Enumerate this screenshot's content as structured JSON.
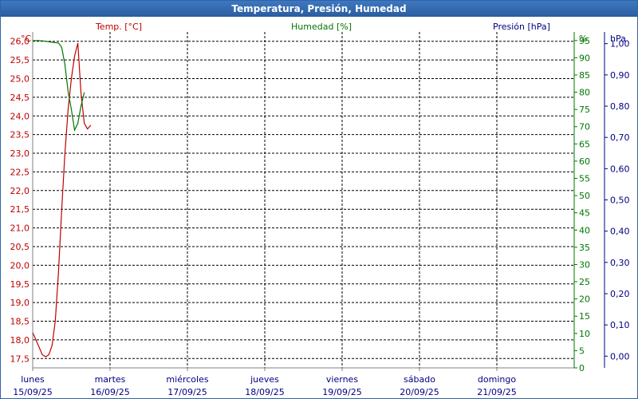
{
  "window": {
    "title": "Temperatura, Presión, Humedad"
  },
  "colors": {
    "temp": "#c00000",
    "hum": "#007700",
    "pres": "#000080",
    "grid": "#000000",
    "title_bg": "#2f63a8"
  },
  "chart_data": {
    "type": "line",
    "title": "Temperatura, Presión, Humedad",
    "grid": true,
    "axes": {
      "temp": {
        "label": "Temp. [°C]",
        "unit": "°C",
        "min": 17.25,
        "max": 26.25,
        "ticks": [
          "17,5",
          "18,0",
          "18,5",
          "19,0",
          "19,5",
          "20,0",
          "20,5",
          "21,0",
          "21,5",
          "22,0",
          "22,5",
          "23,0",
          "23,5",
          "24,0",
          "24,5",
          "25,0",
          "25,5",
          "26,0"
        ]
      },
      "hum": {
        "label": "Humedad [%]",
        "unit": "%",
        "min": 0,
        "max": 97.5,
        "ticks": [
          "0",
          "5",
          "10",
          "15",
          "20",
          "25",
          "30",
          "35",
          "40",
          "45",
          "50",
          "55",
          "60",
          "65",
          "70",
          "75",
          "80",
          "85",
          "90",
          "95"
        ]
      },
      "pres": {
        "label": "Presión [hPa]",
        "unit": "hPa",
        "min": -0.0375,
        "max": 1.0375,
        "ticks": [
          "0,00",
          "0,10",
          "0,20",
          "0,30",
          "0,40",
          "0,50",
          "0,60",
          "0,70",
          "0,80",
          "0,90",
          "1,00"
        ]
      }
    },
    "x_axis": {
      "min_hours": 0,
      "max_hours": 168,
      "categories": [
        {
          "day": "lunes",
          "date": "15/09/25"
        },
        {
          "day": "martes",
          "date": "16/09/25"
        },
        {
          "day": "miércoles",
          "date": "17/09/25"
        },
        {
          "day": "jueves",
          "date": "18/09/25"
        },
        {
          "day": "viernes",
          "date": "19/09/25"
        },
        {
          "day": "sábado",
          "date": "20/09/25"
        },
        {
          "day": "domingo",
          "date": "21/09/25"
        }
      ]
    },
    "series": [
      {
        "name": "Temp. [°C]",
        "axis": "temp",
        "points": [
          [
            0,
            18.2
          ],
          [
            1,
            18.0
          ],
          [
            2,
            17.8
          ],
          [
            3,
            17.6
          ],
          [
            4,
            17.55
          ],
          [
            5,
            17.6
          ],
          [
            6,
            17.85
          ],
          [
            7,
            18.5
          ],
          [
            8,
            19.8
          ],
          [
            9,
            21.5
          ],
          [
            10,
            23.0
          ],
          [
            11,
            24.2
          ],
          [
            12,
            25.0
          ],
          [
            13,
            25.6
          ],
          [
            14,
            25.95
          ],
          [
            15,
            24.6
          ],
          [
            16,
            23.8
          ],
          [
            17,
            23.65
          ],
          [
            18,
            23.75
          ]
        ]
      },
      {
        "name": "Humedad [%]",
        "axis": "hum",
        "points": [
          [
            0,
            95
          ],
          [
            2,
            95
          ],
          [
            4,
            94.8
          ],
          [
            6,
            94.5
          ],
          [
            8,
            94.3
          ],
          [
            9,
            93
          ],
          [
            10,
            88
          ],
          [
            11,
            80
          ],
          [
            12,
            75
          ],
          [
            13,
            69
          ],
          [
            14,
            71
          ],
          [
            15,
            76
          ],
          [
            16,
            80
          ]
        ]
      }
    ]
  }
}
